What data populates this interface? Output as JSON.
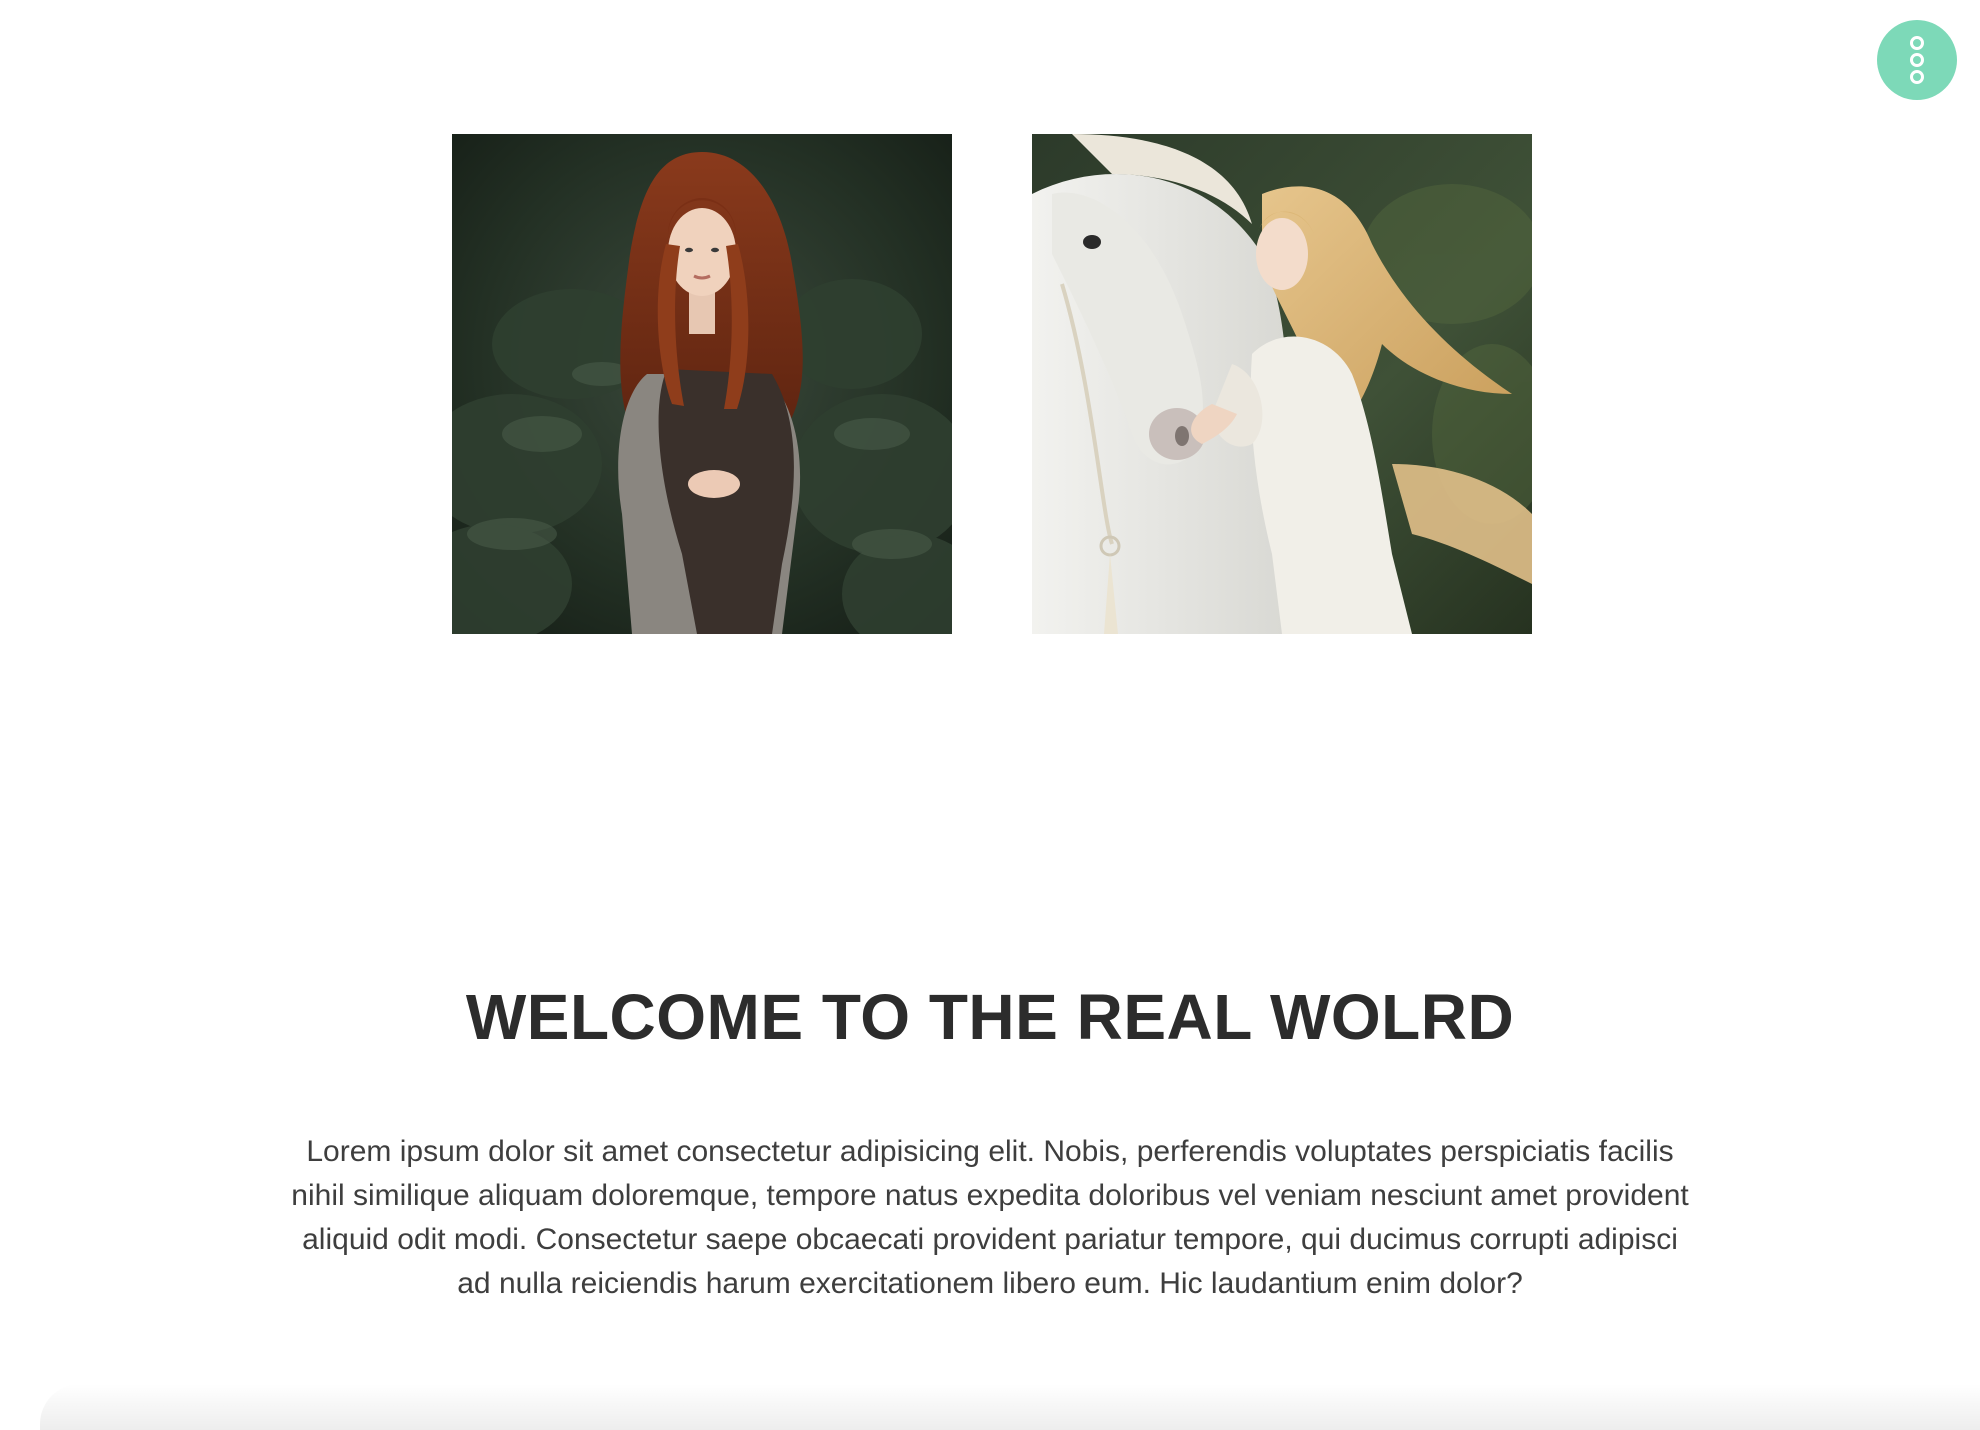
{
  "menu_button": {
    "icon": "three-rings-menu-icon",
    "color": "#7dd9b8"
  },
  "gallery": {
    "photos": [
      {
        "subject": "red-haired woman in knit shawl among evergreen shrubs"
      },
      {
        "subject": "blonde woman in white dress beside white horse"
      }
    ]
  },
  "welcome": {
    "title": "WELCOME TO THE REAL WOLRD",
    "body": "Lorem ipsum dolor sit amet consectetur adipisicing elit. Nobis, perferendis voluptates perspiciatis facilis nihil similique aliquam doloremque, tempore natus expedita doloribus vel veniam nesciunt amet provident aliquid odit modi. Consectetur saepe obcaecati provident pariatur tempore, qui ducimus corrupti adipisci ad nulla reiciendis harum exercitationem libero eum. Hic laudantium enim dolor?"
  },
  "colors": {
    "accent": "#7dd9b8",
    "heading": "#2c2c2c",
    "text": "#3e3e3e",
    "background": "#ffffff"
  }
}
